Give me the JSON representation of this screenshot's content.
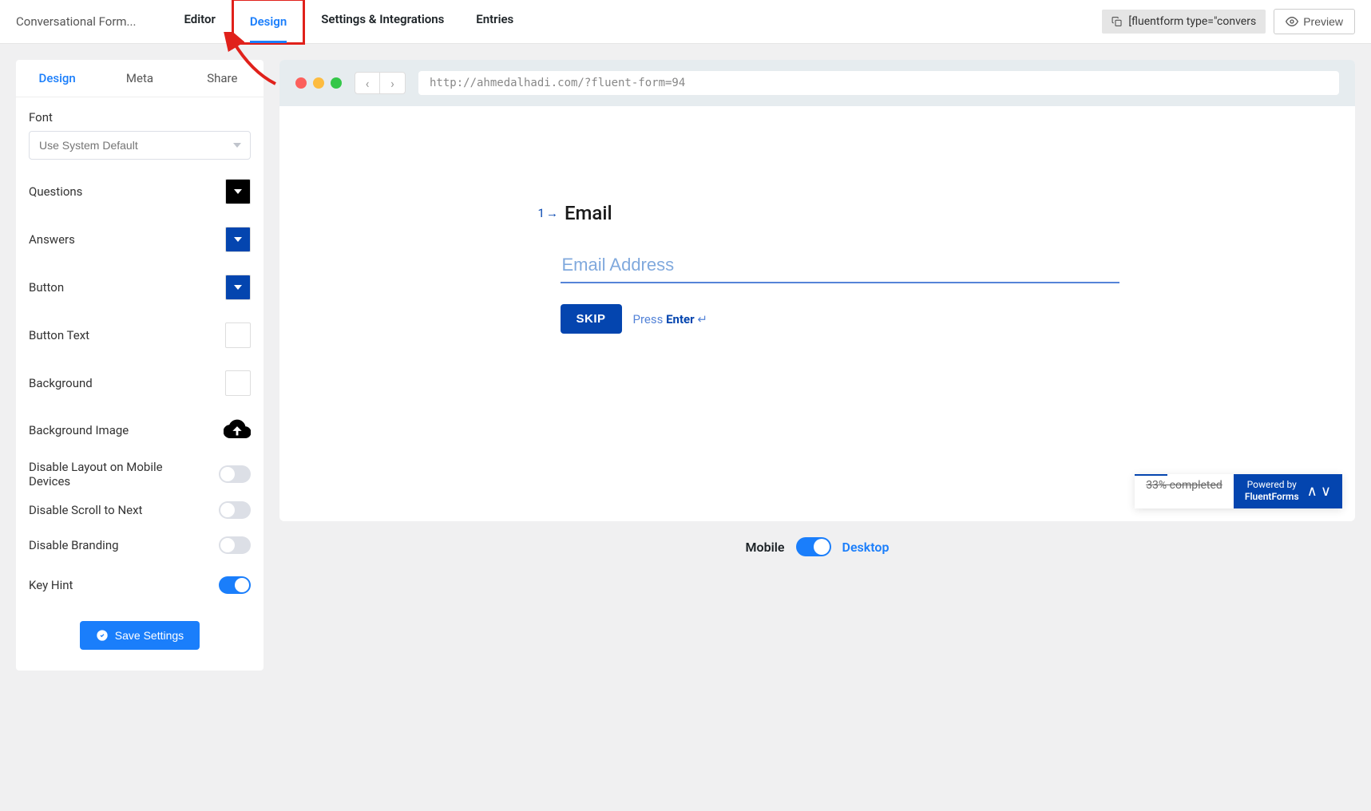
{
  "header": {
    "form_title": "Conversational Form...",
    "tabs": [
      "Editor",
      "Design",
      "Settings & Integrations",
      "Entries"
    ],
    "active_tab": "Design",
    "shortcode": "[fluentform type=\"convers",
    "preview_label": "Preview"
  },
  "sidebar": {
    "tabs": [
      "Design",
      "Meta",
      "Share"
    ],
    "active_tab": "Design",
    "font_label": "Font",
    "font_value": "Use System Default",
    "rows": {
      "questions": "Questions",
      "answers": "Answers",
      "button": "Button",
      "button_text": "Button Text",
      "background": "Background",
      "background_image": "Background Image",
      "disable_layout_mobile": "Disable Layout on Mobile Devices",
      "disable_scroll": "Disable Scroll to Next",
      "disable_branding": "Disable Branding",
      "key_hint": "Key Hint"
    },
    "colors": {
      "questions": "#000000",
      "answers": "#0445af",
      "button": "#0445af",
      "button_text": "#ffffff",
      "background": "#ffffff"
    },
    "toggles": {
      "disable_layout_mobile": false,
      "disable_scroll": false,
      "disable_branding": false,
      "key_hint": true
    },
    "save_label": "Save Settings"
  },
  "preview": {
    "url": "http://ahmedalhadi.com/?fluent-form=94",
    "question_number": "1",
    "question_title": "Email",
    "input_placeholder": "Email Address",
    "skip_label": "SKIP",
    "hint_prefix": "Press ",
    "hint_key": "Enter",
    "hint_symbol": "↵",
    "progress_text": "33% completed",
    "powered_prefix": "Powered by",
    "powered_brand": "FluentForms"
  },
  "device_toggle": {
    "left": "Mobile",
    "right": "Desktop"
  }
}
